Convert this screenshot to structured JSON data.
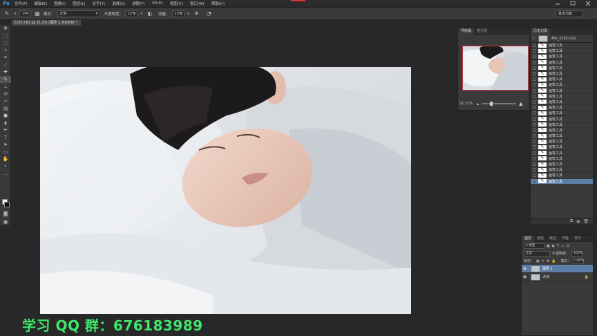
{
  "app": {
    "logo": "Ps",
    "menu": [
      "文件(F)",
      "编辑(E)",
      "图像(I)",
      "图层(L)",
      "文字(Y)",
      "选择(S)",
      "滤镜(T)",
      "3D(D)",
      "视图(V)",
      "窗口(W)",
      "帮助(H)"
    ]
  },
  "options": {
    "brush_size": "19",
    "mode_label": "模式：",
    "mode_value": "正常",
    "opacity_label": "不透明度：",
    "opacity_value": "22%",
    "flow_label": "流量：",
    "flow_value": "23%",
    "workspace": "基本功能"
  },
  "document": {
    "tab_title": "2162.CR2 @ 21.2% (图层 1, RGB/8) *"
  },
  "navigator": {
    "tabs": [
      "导航器",
      "直方图"
    ],
    "zoom": "21.22%"
  },
  "history": {
    "tab": "历史记录",
    "snapshot": "IMG_2162.CR2",
    "items": [
      "画笔工具",
      "画笔工具",
      "画笔工具",
      "画笔工具",
      "画笔工具",
      "画笔工具",
      "画笔工具",
      "画笔工具",
      "画笔工具",
      "画笔工具",
      "画笔工具",
      "画笔工具",
      "画笔工具",
      "画笔工具",
      "画笔工具",
      "画笔工具",
      "画笔工具",
      "画笔工具",
      "画笔工具",
      "画笔工具",
      "画笔工具",
      "画笔工具",
      "画笔工具",
      "画笔工具",
      "画笔工具"
    ],
    "selected_index": 24
  },
  "layers": {
    "tabs": [
      "图层",
      "通道",
      "路径",
      "调整",
      "样式"
    ],
    "kind_filter": "ρ 类型",
    "blend_mode": "正常",
    "opacity_label": "不透明度：",
    "opacity_value": "100%",
    "lock_label": "锁定：",
    "fill_label": "填充：",
    "fill_value": "100%",
    "rows": [
      {
        "name": "图层 1",
        "selected": true
      },
      {
        "name": "背景",
        "selected": false
      }
    ]
  },
  "overlay": {
    "text": "学习 QQ 群：676183989",
    "color": "#3ee66c"
  }
}
